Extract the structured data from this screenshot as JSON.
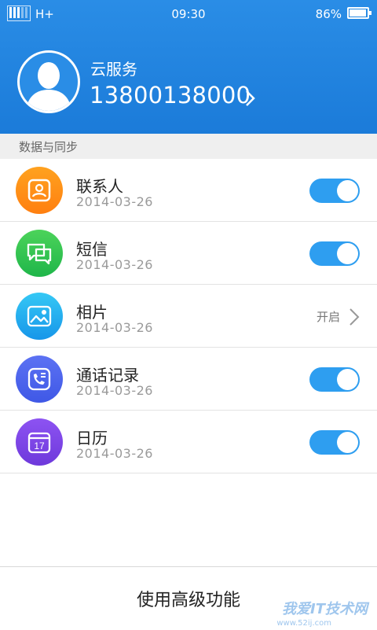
{
  "status_bar": {
    "network": "H+",
    "time": "09:30",
    "battery": "86%"
  },
  "profile": {
    "label": "云服务",
    "account": "13800138000"
  },
  "section": {
    "title": "数据与同步"
  },
  "items": [
    {
      "title": "联系人",
      "date": "2014-03-26",
      "icon": "contact-icon",
      "color_from": "#ffa21f",
      "color_to": "#ff7f10",
      "toggle": true
    },
    {
      "title": "短信",
      "date": "2014-03-26",
      "icon": "message-icon",
      "color_from": "#4cd35a",
      "color_to": "#1fb64a",
      "toggle": true
    },
    {
      "title": "相片",
      "date": "2014-03-26",
      "icon": "photo-icon",
      "color_from": "#35c8f5",
      "color_to": "#1796e9",
      "status": "开启"
    },
    {
      "title": "通话记录",
      "date": "2014-03-26",
      "icon": "call-log-icon",
      "color_from": "#5c72f3",
      "color_to": "#3f58e6",
      "toggle": true
    },
    {
      "title": "日历",
      "date": "2014-03-26",
      "icon": "calendar-icon",
      "color_from": "#8d53f2",
      "color_to": "#6e39db",
      "toggle": true,
      "calendar_day": "17"
    }
  ],
  "bottom": {
    "button_label": "使用高级功能"
  },
  "watermark": {
    "text": "我爱IT技术网",
    "url": "www.52ij.com"
  },
  "colors": {
    "header": "#1b7bd9",
    "toggle_on": "#2e9ef0"
  }
}
